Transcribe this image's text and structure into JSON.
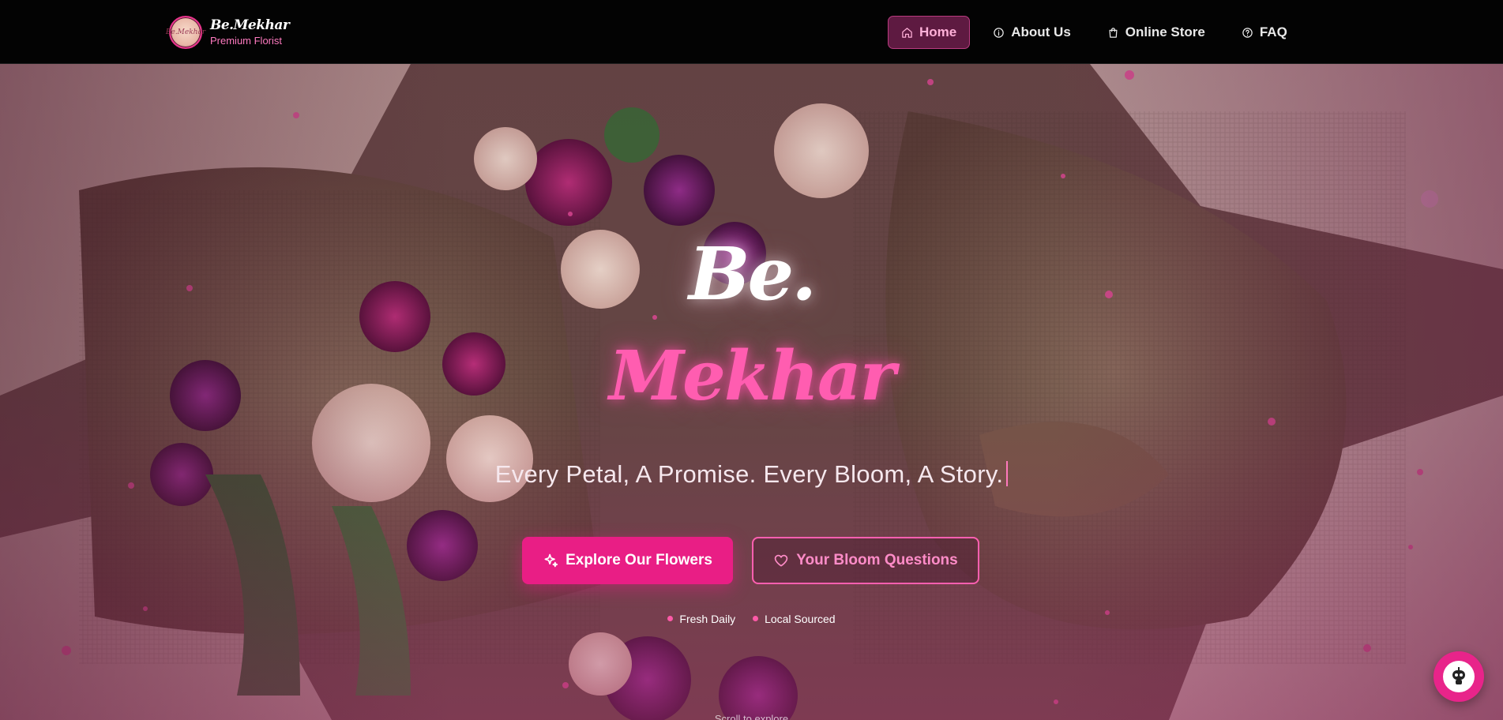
{
  "brand": {
    "logo_text": "Be.Mekhar",
    "name": "Be.Mekhar",
    "tagline": "Premium Florist"
  },
  "nav": {
    "items": [
      {
        "label": "Home",
        "icon": "home-icon",
        "active": true
      },
      {
        "label": "About Us",
        "icon": "info-icon",
        "active": false
      },
      {
        "label": "Online Store",
        "icon": "shopping-bag-icon",
        "active": false
      },
      {
        "label": "FAQ",
        "icon": "help-circle-icon",
        "active": false
      }
    ]
  },
  "hero": {
    "title_line1": "Be.",
    "title_line2": "Mekhar",
    "tagline": "Every Petal, A Promise. Every Bloom, A Story.",
    "primary_button": "Explore Our Flowers",
    "primary_icon": "sparkles-icon",
    "secondary_button": "Your Bloom Questions",
    "secondary_icon": "heart-icon",
    "features": [
      "Fresh Daily",
      "Local Sourced"
    ],
    "scroll_hint": "Scroll to explore"
  },
  "chat_widget": {
    "icon": "chat-bot-icon"
  },
  "colors": {
    "accent": "#e91e85",
    "accent_light": "#ff5db0",
    "nav_bg": "#030303",
    "active_nav_bg": "#5e1a41"
  }
}
